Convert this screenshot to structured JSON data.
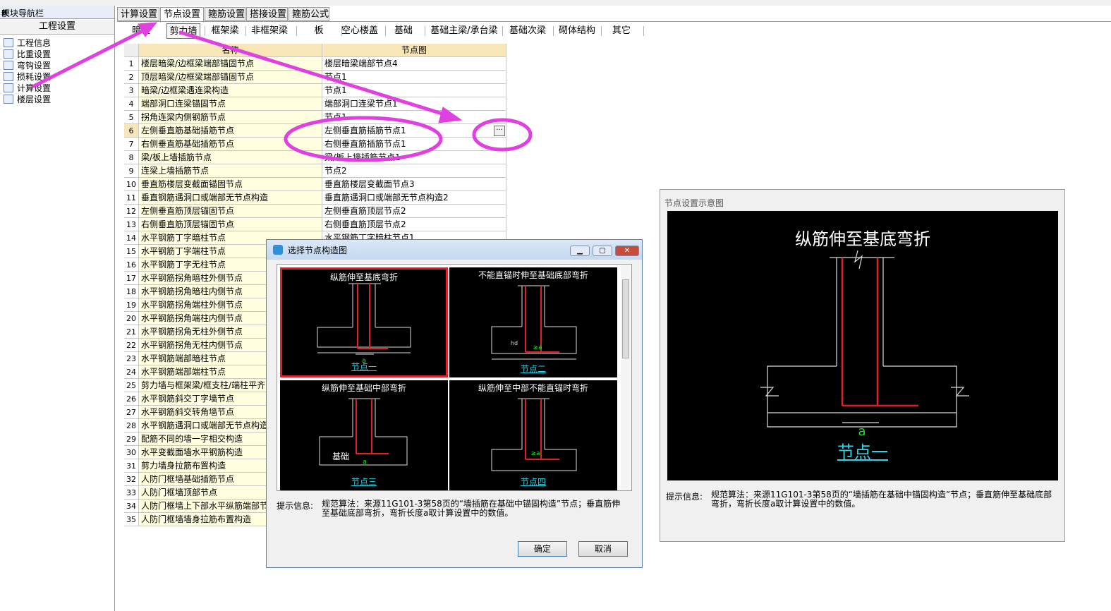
{
  "nav": {
    "title": "模块导航栏",
    "pin": "ᵽ",
    "close": "×",
    "section": "工程设置",
    "items": [
      {
        "label": "工程信息",
        "icon": "info-icon"
      },
      {
        "label": "比重设置",
        "icon": "weight-icon"
      },
      {
        "label": "弯钩设置",
        "icon": "hook-icon"
      },
      {
        "label": "损耗设置",
        "icon": "loss-icon"
      },
      {
        "label": "计算设置",
        "icon": "calc-icon"
      },
      {
        "label": "楼层设置",
        "icon": "floor-icon"
      }
    ]
  },
  "tabs": [
    "计算设置",
    "节点设置",
    "箍筋设置",
    "搭接设置",
    "箍筋公式"
  ],
  "active_tab": "节点设置",
  "subtabs": [
    "暗柱",
    "剪力墙",
    "框架梁",
    "非框架梁",
    "板",
    "空心楼盖",
    "基础",
    "基础主梁/承台梁",
    "基础次梁",
    "砌体结构",
    "其它"
  ],
  "active_subtab": "剪力墙",
  "grid": {
    "headers": [
      "名称",
      "节点图"
    ],
    "rows": [
      {
        "idx": "1",
        "name": "楼层暗梁/边框梁端部锚固节点",
        "node": "楼层暗梁端部节点4"
      },
      {
        "idx": "2",
        "name": "顶层暗梁/边框梁端部锚固节点",
        "node": "节点1"
      },
      {
        "idx": "3",
        "name": "暗梁/边框梁遇连梁构造",
        "node": "节点1"
      },
      {
        "idx": "4",
        "name": "端部洞口连梁锚固节点",
        "node": "端部洞口连梁节点1"
      },
      {
        "idx": "5",
        "name": "拐角连梁内侧钢筋节点",
        "node": "节点1"
      },
      {
        "idx": "6",
        "name": "左侧垂直筋基础插筋节点",
        "node": "左侧垂直筋插筋节点1"
      },
      {
        "idx": "7",
        "name": "右侧垂直筋基础插筋节点",
        "node": "右侧垂直筋插筋节点1"
      },
      {
        "idx": "8",
        "name": "梁/板上墙插筋节点",
        "node": "梁/板上墙插筋节点1"
      },
      {
        "idx": "9",
        "name": "连梁上墙插筋节点",
        "node": "节点2"
      },
      {
        "idx": "10",
        "name": "垂直筋楼层变截面锚固节点",
        "node": "垂直筋楼层变截面节点3"
      },
      {
        "idx": "11",
        "name": "垂直钢筋遇洞口或端部无节点构造",
        "node": "垂直筋遇洞口或端部无节点构造2"
      },
      {
        "idx": "12",
        "name": "左侧垂直筋顶层锚固节点",
        "node": "左侧垂直筋顶层节点2"
      },
      {
        "idx": "13",
        "name": "右侧垂直筋顶层锚固节点",
        "node": "右侧垂直筋顶层节点2"
      },
      {
        "idx": "14",
        "name": "水平钢筋丁字暗柱节点",
        "node": "水平钢筋丁字暗柱节点1"
      },
      {
        "idx": "15",
        "name": "水平钢筋丁字端柱节点",
        "node": ""
      },
      {
        "idx": "16",
        "name": "水平钢筋丁字无柱节点",
        "node": ""
      },
      {
        "idx": "17",
        "name": "水平钢筋拐角暗柱外侧节点",
        "node": ""
      },
      {
        "idx": "18",
        "name": "水平钢筋拐角暗柱内侧节点",
        "node": ""
      },
      {
        "idx": "19",
        "name": "水平钢筋拐角端柱外侧节点",
        "node": ""
      },
      {
        "idx": "20",
        "name": "水平钢筋拐角端柱内侧节点",
        "node": ""
      },
      {
        "idx": "21",
        "name": "水平钢筋拐角无柱外侧节点",
        "node": ""
      },
      {
        "idx": "22",
        "name": "水平钢筋拐角无柱内侧节点",
        "node": ""
      },
      {
        "idx": "23",
        "name": "水平钢筋端部暗柱节点",
        "node": ""
      },
      {
        "idx": "24",
        "name": "水平钢筋端部端柱节点",
        "node": ""
      },
      {
        "idx": "25",
        "name": "剪力墙与框架梁/框支柱/端柱平齐",
        "node": ""
      },
      {
        "idx": "26",
        "name": "水平钢筋斜交丁字墙节点",
        "node": ""
      },
      {
        "idx": "27",
        "name": "水平钢筋斜交转角墙节点",
        "node": ""
      },
      {
        "idx": "28",
        "name": "水平钢筋遇洞口或端部无节点构造",
        "node": ""
      },
      {
        "idx": "29",
        "name": "配筋不同的墙一字相交构造",
        "node": ""
      },
      {
        "idx": "30",
        "name": "水平变截面墙水平钢筋构造",
        "node": ""
      },
      {
        "idx": "31",
        "name": "剪力墙身拉筋布置构造",
        "node": ""
      },
      {
        "idx": "32",
        "name": "人防门框墙基础插筋节点",
        "node": ""
      },
      {
        "idx": "33",
        "name": "人防门框墙顶部节点",
        "node": ""
      },
      {
        "idx": "34",
        "name": "人防门框墙上下部水平纵筋端部节",
        "node": ""
      },
      {
        "idx": "35",
        "name": "人防门框墙墙身拉筋布置构造",
        "node": ""
      }
    ]
  },
  "ellipsis": "···",
  "dialog": {
    "title": "选择节点构造图",
    "thumbs": [
      {
        "caption": "纵筋伸至基底弯折",
        "label": "节点一",
        "marks": [
          "a"
        ]
      },
      {
        "caption": "不能直锚时伸至基础底部弯折",
        "label": "节点二",
        "marks": [
          "≥a",
          "hd"
        ]
      },
      {
        "caption": "纵筋伸至基础中部弯折",
        "label": "节点三",
        "marks": [
          "基础",
          "a"
        ]
      },
      {
        "caption": "纵筋伸至中部不能直锚时弯折",
        "label": "节点四",
        "marks": [
          "≥a"
        ]
      }
    ],
    "info_label": "提示信息:",
    "info_text": "规范算法：来源11G101-3第58页的“墙插筋在基础中锚固构造”节点；垂直筋伸至基础底部弯折，弯折长度a取计算设置中的数值。",
    "ok": "确定",
    "cancel": "取消"
  },
  "preview": {
    "title": "节点设置示意图",
    "caption": "纵筋伸至基底弯折",
    "mark": "a",
    "node": "节点一",
    "info_label": "提示信息:",
    "info_text": "规范算法：来源11G101-3第58页的“墙插筋在基础中锚固构造”节点；垂直筋伸至基础底部弯折，弯折长度a取计算设置中的数值。"
  },
  "colors": {
    "annotation": "#e040e0",
    "rebar": "#e0202a",
    "cyan_label": "#2bd3e6",
    "dimension_green": "#22dd22"
  }
}
